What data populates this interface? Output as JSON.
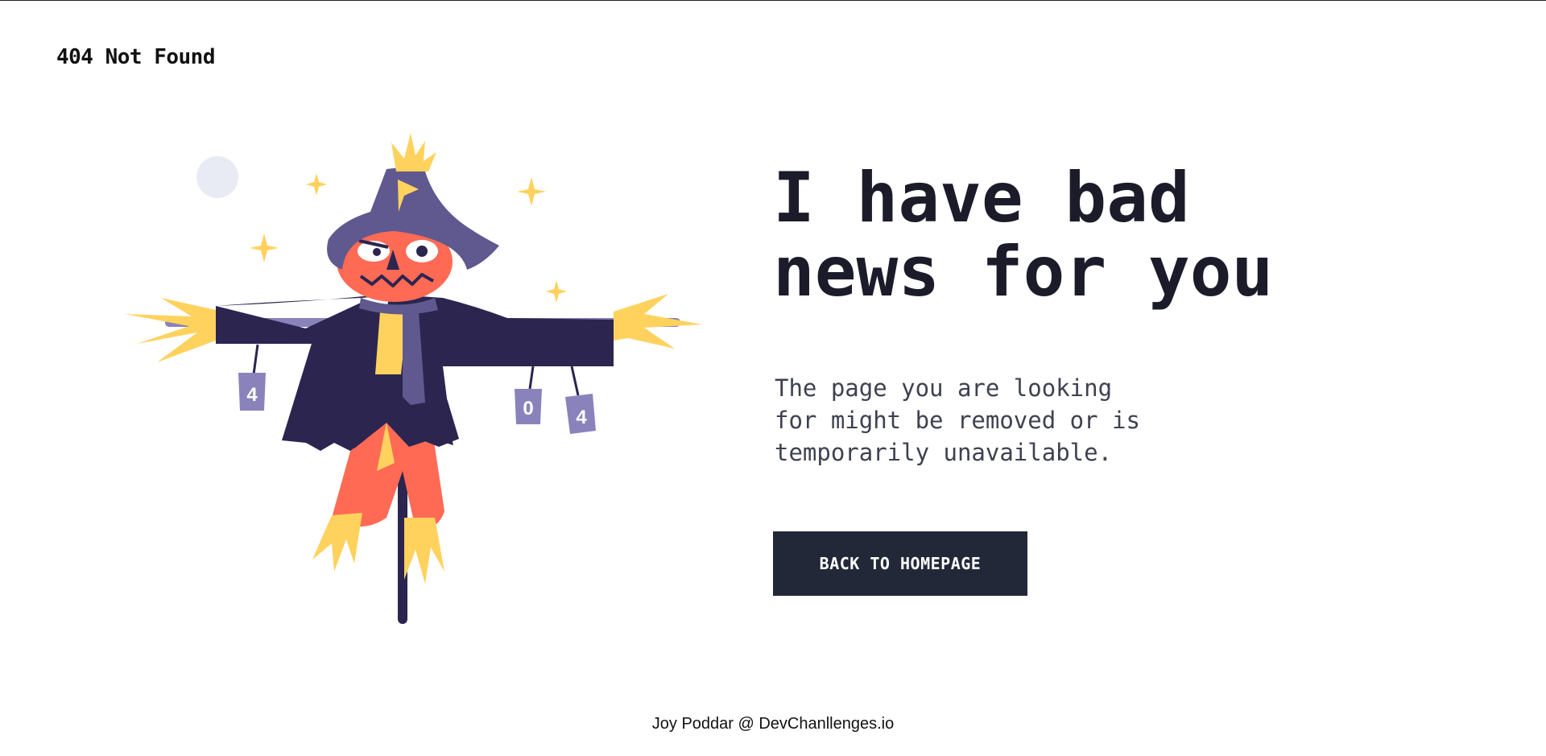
{
  "header": {
    "title": "404 Not Found"
  },
  "illustration": {
    "cans": [
      "4",
      "0",
      "4"
    ],
    "colors": {
      "coat": "#2b2550",
      "hat": "#5f598f",
      "face": "#ff6a55",
      "straw": "#ffd25e",
      "can": "#8a83bb",
      "moon": "#e9ebf4"
    }
  },
  "main": {
    "headline_lines": [
      "I have bad",
      "news for you"
    ],
    "message_lines": [
      "The page you are looking",
      "for might be removed or is",
      "temporarily unavailable."
    ],
    "button_label": "BACK TO HOMEPAGE"
  },
  "footer": {
    "credit": "Joy Poddar @ DevChanllenges.io"
  },
  "colors": {
    "button_bg": "#222838",
    "headline": "#1b1b2a",
    "body_text": "#3e4150"
  }
}
